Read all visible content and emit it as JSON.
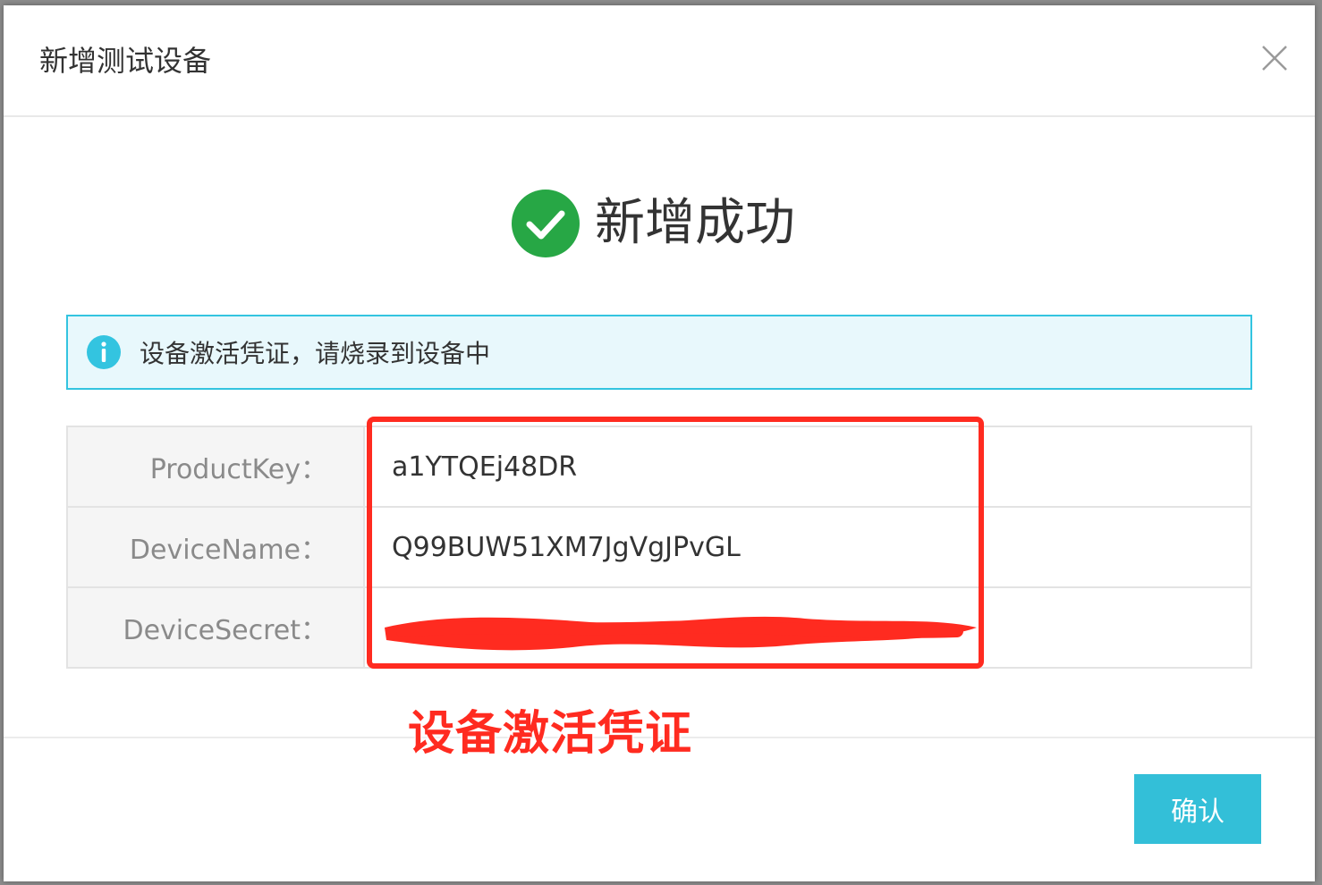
{
  "dialog": {
    "title": "新增测试设备",
    "close_icon": "close-icon"
  },
  "success": {
    "icon": "check-circle-icon",
    "text": "新增成功",
    "color": "#27a745"
  },
  "alert": {
    "icon": "info-icon",
    "text": "设备激活凭证，请烧录到设备中",
    "accent": "#33c4e0"
  },
  "credentials": {
    "rows": [
      {
        "label": "ProductKey：",
        "value": "a1YTQEj48DR"
      },
      {
        "label": "DeviceName：",
        "value": "Q99BUW51XM7JgVgJPvGL"
      },
      {
        "label": "DeviceSecret：",
        "value": ""
      }
    ]
  },
  "annotation": {
    "text": "设备激活凭证",
    "color": "#ff2b20"
  },
  "footer": {
    "confirm_label": "确认"
  }
}
